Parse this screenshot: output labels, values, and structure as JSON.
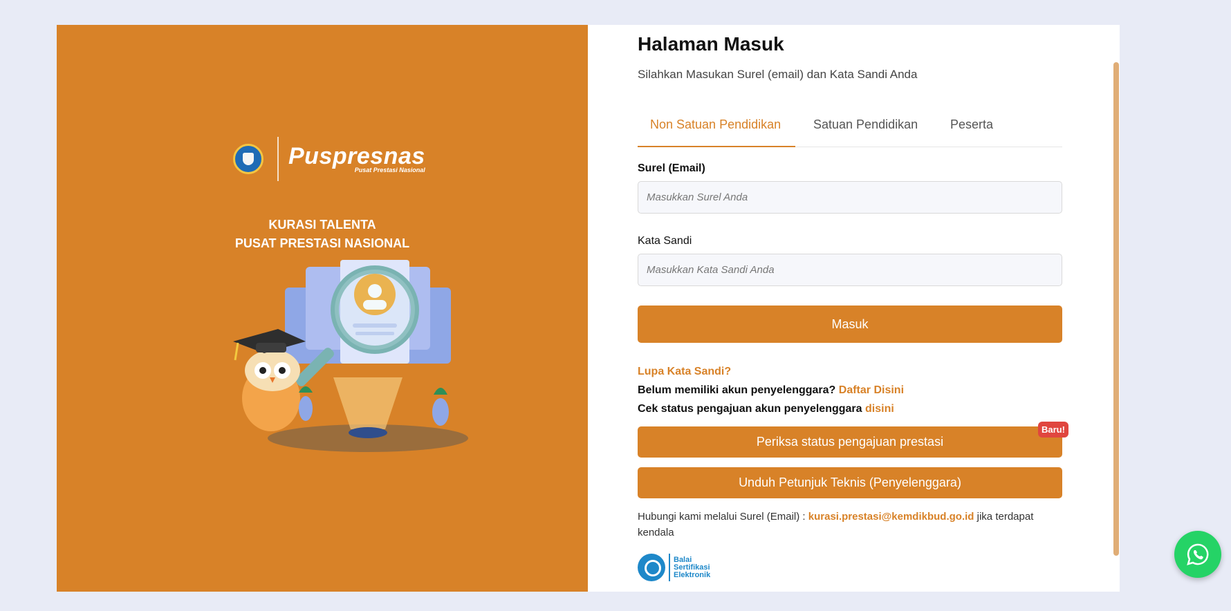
{
  "brand": {
    "name": "Puspresnas",
    "subname": "Pusat Prestasi Nasional",
    "hero_line1": "KURASI TALENTA",
    "hero_line2": "PUSAT PRESTASI NASIONAL"
  },
  "form": {
    "title": "Halaman Masuk",
    "subtitle": "Silahkan Masukan Surel (email) dan Kata Sandi Anda",
    "tabs": [
      {
        "label": "Non Satuan Pendidikan",
        "active": true
      },
      {
        "label": "Satuan Pendidikan",
        "active": false
      },
      {
        "label": "Peserta",
        "active": false
      }
    ],
    "email_label": "Surel (Email)",
    "email_placeholder": "Masukkan Surel Anda",
    "password_label": "Kata Sandi",
    "password_placeholder": "Masukkan Kata Sandi Anda",
    "submit_label": "Masuk",
    "forgot_label": "Lupa Kata Sandi?",
    "register_text": "Belum memiliki akun penyelenggara?",
    "register_link": "Daftar Disini",
    "status_text": "Cek status pengajuan akun penyelenggara",
    "status_link": "disini",
    "check_status_button": "Periksa status pengajuan prestasi",
    "new_badge": "Baru!",
    "download_button": "Unduh Petunjuk Teknis (Penyelenggara)",
    "contact_text": "Hubungi kami melalui Surel (Email) :",
    "contact_email": "kurasi.prestasi@kemdikbud.go.id",
    "contact_suffix": "jika terdapat kendala"
  },
  "footer_logo": {
    "line1": "Balai",
    "line2": "Sertifikasi",
    "line3": "Elektronik"
  },
  "colors": {
    "accent": "#d88228",
    "badge": "#e0463f",
    "whatsapp": "#25d366"
  },
  "icons": {
    "floating_button": "whatsapp-icon"
  }
}
